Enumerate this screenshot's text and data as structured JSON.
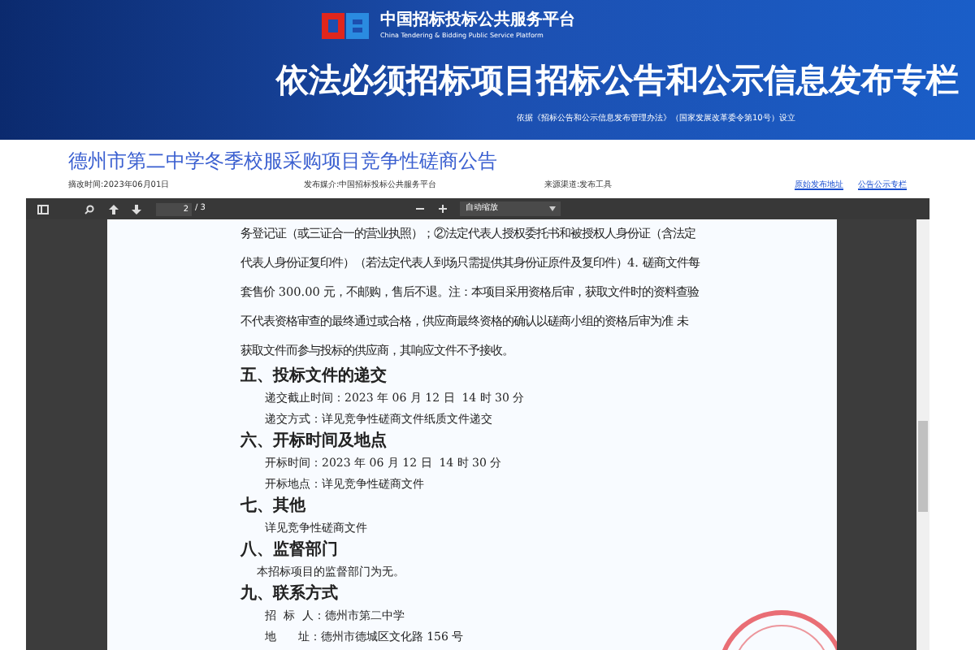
{
  "banner": {
    "platform_name": "中国招标投标公共服务平台",
    "platform_name_en": "China Tendering & Bidding Public Service Platform",
    "title": "依法必须招标项目招标公告和公示信息发布专栏",
    "subtitle": "依据《招标公告和公示信息发布管理办法》（国家发展改革委令第10号）设立"
  },
  "notice": {
    "title": "德州市第二中学冬季校服采购项目竞争性磋商公告",
    "meta": [
      "摘改时间:2023年06月01日",
      "发布媒介:中国招标投标公共服务平台",
      "来源渠道:发布工具"
    ],
    "links": [
      "原始发布地址",
      "公告公示专栏"
    ]
  },
  "viewer": {
    "page_number": "2",
    "page_count": "/ 3",
    "zoom": "自动缩放",
    "document": [
      {
        "kind": "line",
        "text": "务登记证（或三证合一的营业执照）；②法定代表人授权委托书和被授权人身份证（含法定"
      },
      {
        "kind": "line",
        "text": "代表人身份证复印件）（若法定代表人到场只需提供其身份证原件及复印件）4. 磋商文件每"
      },
      {
        "kind": "line",
        "text": "套售价 300.00 元，不邮购，售后不退。注：本项目采用资格后审，获取文件时的资料查验"
      },
      {
        "kind": "line",
        "text": "不代表资格审查的最终通过或合格，供应商最终资格的确认以磋商小组的资格后审为准 未"
      },
      {
        "kind": "line",
        "text": "获取文件而参与投标的供应商，其响应文件不予接收。"
      },
      {
        "kind": "heading",
        "text": "五、投标文件的递交"
      },
      {
        "kind": "item",
        "text": "递交截止时间：2023 年 06 月 12 日  14 时 30 分"
      },
      {
        "kind": "item",
        "text": "递交方式：详见竞争性磋商文件纸质文件递交"
      },
      {
        "kind": "heading",
        "text": "六、开标时间及地点"
      },
      {
        "kind": "item",
        "text": "开标时间：2023 年 06 月 12 日  14 时 30 分"
      },
      {
        "kind": "item",
        "text": "开标地点：详见竞争性磋商文件"
      },
      {
        "kind": "heading",
        "text": "七、其他"
      },
      {
        "kind": "item",
        "text": "详见竞争性磋商文件"
      },
      {
        "kind": "heading",
        "text": "八、监督部门"
      },
      {
        "kind": "note",
        "text": "本招标项目的监督部门为无。"
      },
      {
        "kind": "heading",
        "text": "九、联系方式"
      },
      {
        "kind": "item",
        "text": "招  标  人：德州市第二中学"
      },
      {
        "kind": "item",
        "text": "地      址：德州市德城区文化路 156 号"
      }
    ]
  }
}
